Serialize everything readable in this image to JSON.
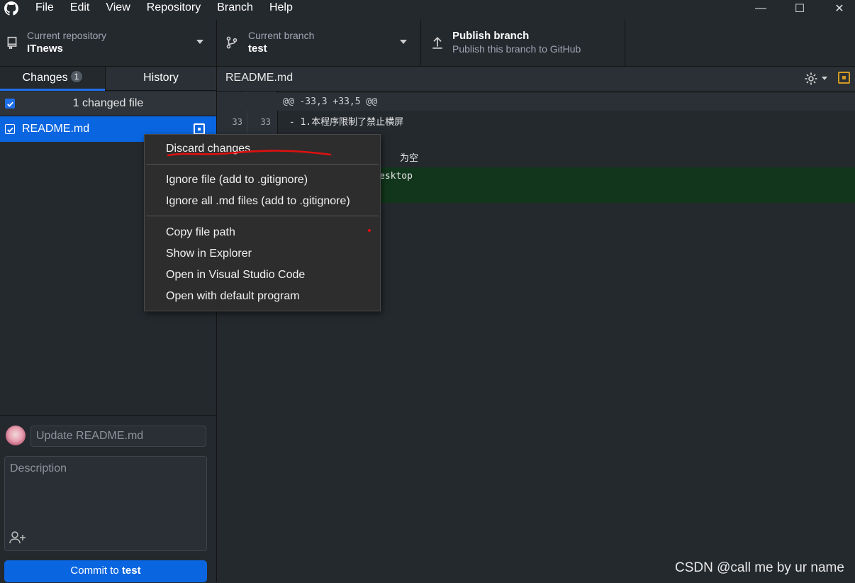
{
  "menu": [
    "File",
    "Edit",
    "View",
    "Repository",
    "Branch",
    "Help"
  ],
  "window_controls": {
    "minimize": "—",
    "maximize": "☐",
    "close": "✕"
  },
  "toolbar": {
    "repo": {
      "label": "Current repository",
      "value": "ITnews"
    },
    "branch": {
      "label": "Current branch",
      "value": "test"
    },
    "publish": {
      "title": "Publish branch",
      "subtitle": "Publish this branch to GitHub"
    }
  },
  "sidebar": {
    "tabs": [
      {
        "label": "Changes",
        "count": "1"
      },
      {
        "label": "History"
      }
    ],
    "changed_files_label": "1 changed file",
    "files": [
      {
        "name": "README.md",
        "checked": true
      }
    ]
  },
  "commit": {
    "summary_placeholder": "Update README.md",
    "description_placeholder": "Description",
    "button_prefix": "Commit to ",
    "button_branch": "test"
  },
  "diff": {
    "file": "README.md",
    "hunk_header": "@@ -33,3 +33,5 @@",
    "lines": [
      {
        "old": "33",
        "new": "33",
        "text": " - 1.本程序限制了禁止横屏",
        "added": false
      },
      {
        "old": "",
        "new": "",
        "text": "",
        "added": false
      },
      {
        "old": "",
        "new": "",
        "text": "为空",
        "added": false
      },
      {
        "old": "",
        "new": "",
        "text": "esktop",
        "added": true
      },
      {
        "old": "",
        "new": "",
        "text": "",
        "added": true
      }
    ]
  },
  "context_menu": {
    "items": [
      {
        "label": "Discard changes..."
      },
      {
        "label": "Ignore file (add to .gitignore)"
      },
      {
        "label": "Ignore all .md files (add to .gitignore)"
      },
      {
        "label": "Copy file path"
      },
      {
        "label": "Show in Explorer"
      },
      {
        "label": "Open in Visual Studio Code"
      },
      {
        "label": "Open with default program"
      }
    ]
  },
  "watermark": "CSDN @call me by ur name",
  "colors": {
    "accent": "#0a66e0",
    "added_bg": "#12361b",
    "annotation_red": "#e01010",
    "modified_icon": "#d29922"
  }
}
